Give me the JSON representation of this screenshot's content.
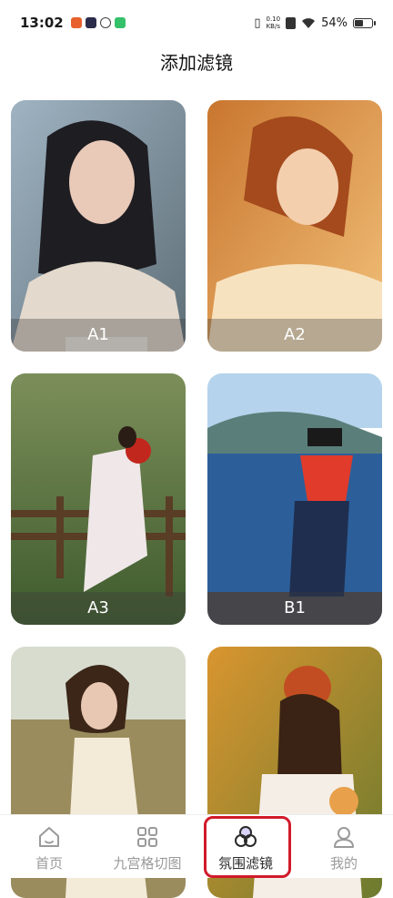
{
  "status": {
    "time": "13:02",
    "speed_value": "0.10",
    "speed_unit": "KB/s",
    "battery": "54%",
    "battery_level": 0.54
  },
  "header": {
    "title": "添加滤镜"
  },
  "filters": [
    {
      "label": "A1"
    },
    {
      "label": "A2"
    },
    {
      "label": "A3"
    },
    {
      "label": "B1"
    },
    {
      "label": ""
    },
    {
      "label": ""
    }
  ],
  "tabbar": {
    "items": [
      {
        "label": "首页",
        "icon": "home-icon"
      },
      {
        "label": "九宫格切图",
        "icon": "grid-icon"
      },
      {
        "label": "氛围滤镜",
        "icon": "filter-circles-icon"
      },
      {
        "label": "我的",
        "icon": "user-icon"
      }
    ],
    "active_index": 2,
    "highlight_color": "#d11a2a"
  }
}
